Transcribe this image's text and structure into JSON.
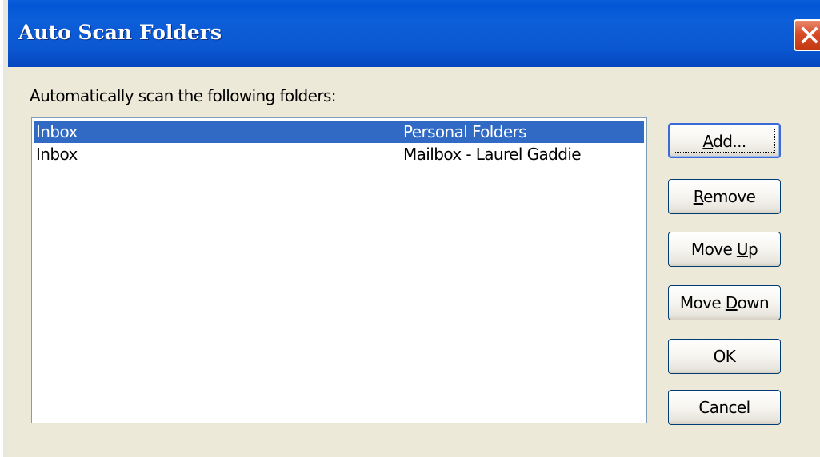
{
  "window": {
    "title": "Auto Scan Folders"
  },
  "prompt": "Automatically scan the following folders:",
  "folders": [
    {
      "name": "Inbox",
      "store": "Personal Folders",
      "selected": true
    },
    {
      "name": "Inbox",
      "store": "Mailbox - Laurel Gaddie",
      "selected": false
    }
  ],
  "buttons": {
    "add": {
      "pre": "",
      "key": "A",
      "post": "dd..."
    },
    "remove": {
      "pre": "",
      "key": "R",
      "post": "emove"
    },
    "move_up": {
      "pre": "Move ",
      "key": "U",
      "post": "p"
    },
    "move_down": {
      "pre": "Move ",
      "key": "D",
      "post": "own"
    },
    "ok": "OK",
    "cancel": "Cancel"
  },
  "icons": {
    "close": "close-icon"
  },
  "colors": {
    "titlebar": "#0a5fd8",
    "selection": "#316ac5",
    "close_button": "#d64b26",
    "dialog_face": "#ece9d8"
  }
}
